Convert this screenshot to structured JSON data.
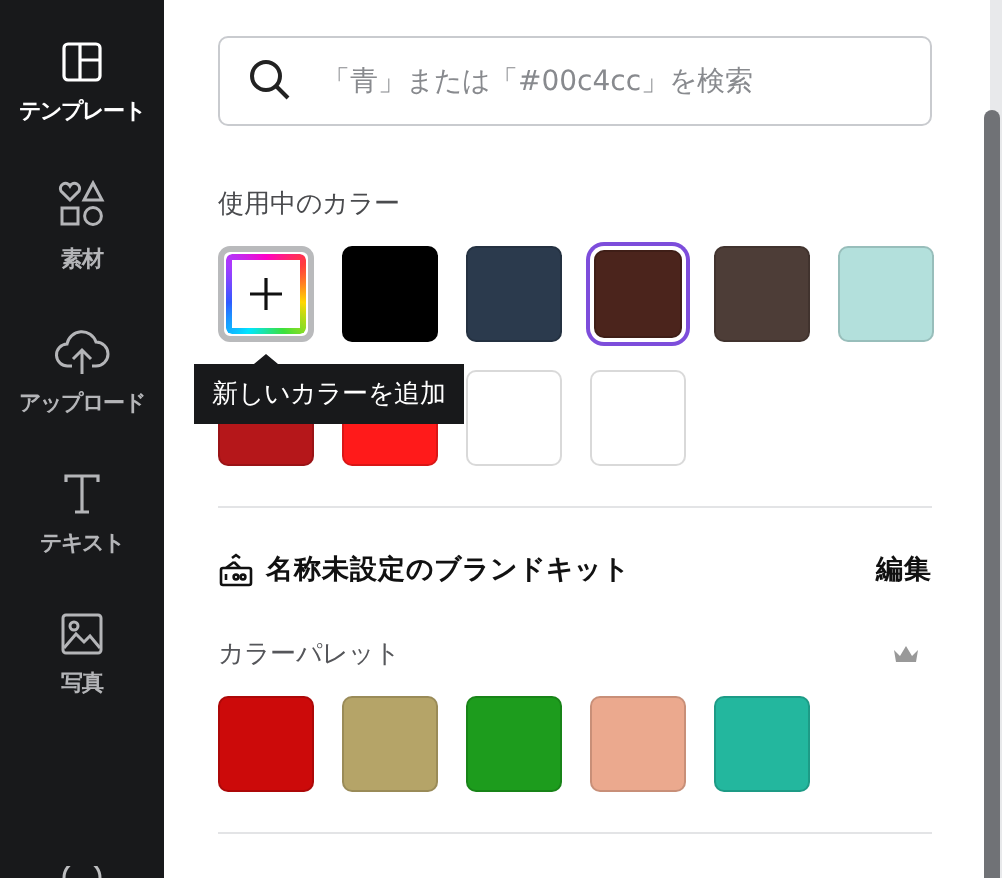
{
  "sidebar": {
    "items": [
      {
        "kind": "template",
        "label": "テンプレート",
        "selected": true
      },
      {
        "kind": "elements",
        "label": "素材",
        "selected": false
      },
      {
        "kind": "upload",
        "label": "アップロード",
        "selected": false
      },
      {
        "kind": "text",
        "label": "テキスト",
        "selected": false
      },
      {
        "kind": "photo",
        "label": "写真",
        "selected": false
      }
    ]
  },
  "search": {
    "placeholder": "「青」または「#00c4cc」を検索"
  },
  "used_colors": {
    "title": "使用中のカラー",
    "add_tooltip": "新しいカラーを追加",
    "swatches": [
      {
        "kind": "add",
        "selected": false
      },
      {
        "kind": "color",
        "color": "#000000",
        "selected": false
      },
      {
        "kind": "color",
        "color": "#2b3a4d",
        "selected": false
      },
      {
        "kind": "color",
        "color": "#4b241c",
        "selected": true
      },
      {
        "kind": "color",
        "color": "#4d3d37",
        "selected": false
      },
      {
        "kind": "color",
        "color": "#b3e0dc",
        "selected": false
      },
      {
        "kind": "color",
        "color": "#b5171a",
        "selected": false
      },
      {
        "kind": "color",
        "color": "#ff1a1a",
        "selected": false
      },
      {
        "kind": "color",
        "color": "#ffffff",
        "selected": false
      },
      {
        "kind": "color",
        "color": "#ffffff",
        "selected": false
      }
    ]
  },
  "brand_kit": {
    "name": "名称未設定のブランドキット",
    "edit": "編集",
    "palette_title": "カラーパレット",
    "palette": [
      {
        "color": "#cc0a0a"
      },
      {
        "color": "#b5a468"
      },
      {
        "color": "#1d9c1d"
      },
      {
        "color": "#eba98e"
      },
      {
        "color": "#23b79e"
      }
    ]
  }
}
